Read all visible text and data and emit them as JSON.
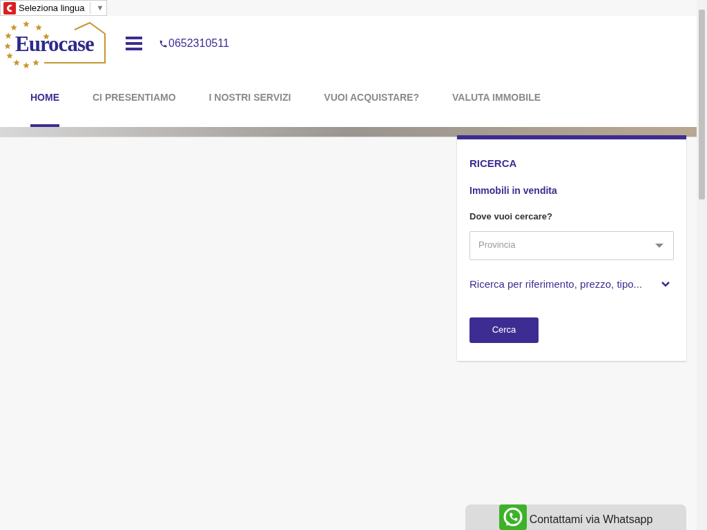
{
  "language_selector": {
    "label": "Seleziona lingua",
    "caret": "▼"
  },
  "header": {
    "logo_text": "Eurocase",
    "phone": "0652310511"
  },
  "nav": [
    {
      "label": "HOME",
      "selected": true
    },
    {
      "label": "CI PRESENTIAMO",
      "selected": false
    },
    {
      "label": "I NOSTRI SERVIZI",
      "selected": false
    },
    {
      "label": "VUOI ACQUISTARE?",
      "selected": false
    },
    {
      "label": "VALUTA IMMOBILE",
      "selected": false
    }
  ],
  "search": {
    "title": "RICERCA",
    "subtitle": "Immobili in vendita",
    "where_label": "Dove vuoi cercare?",
    "province_placeholder": "Provincia",
    "advanced_toggle": "Ricerca per riferimento, prezzo, tipo...",
    "advanced_expanded": false,
    "submit": "Cerca"
  },
  "whatsapp": {
    "label": "Contattami via Whatsapp"
  }
}
